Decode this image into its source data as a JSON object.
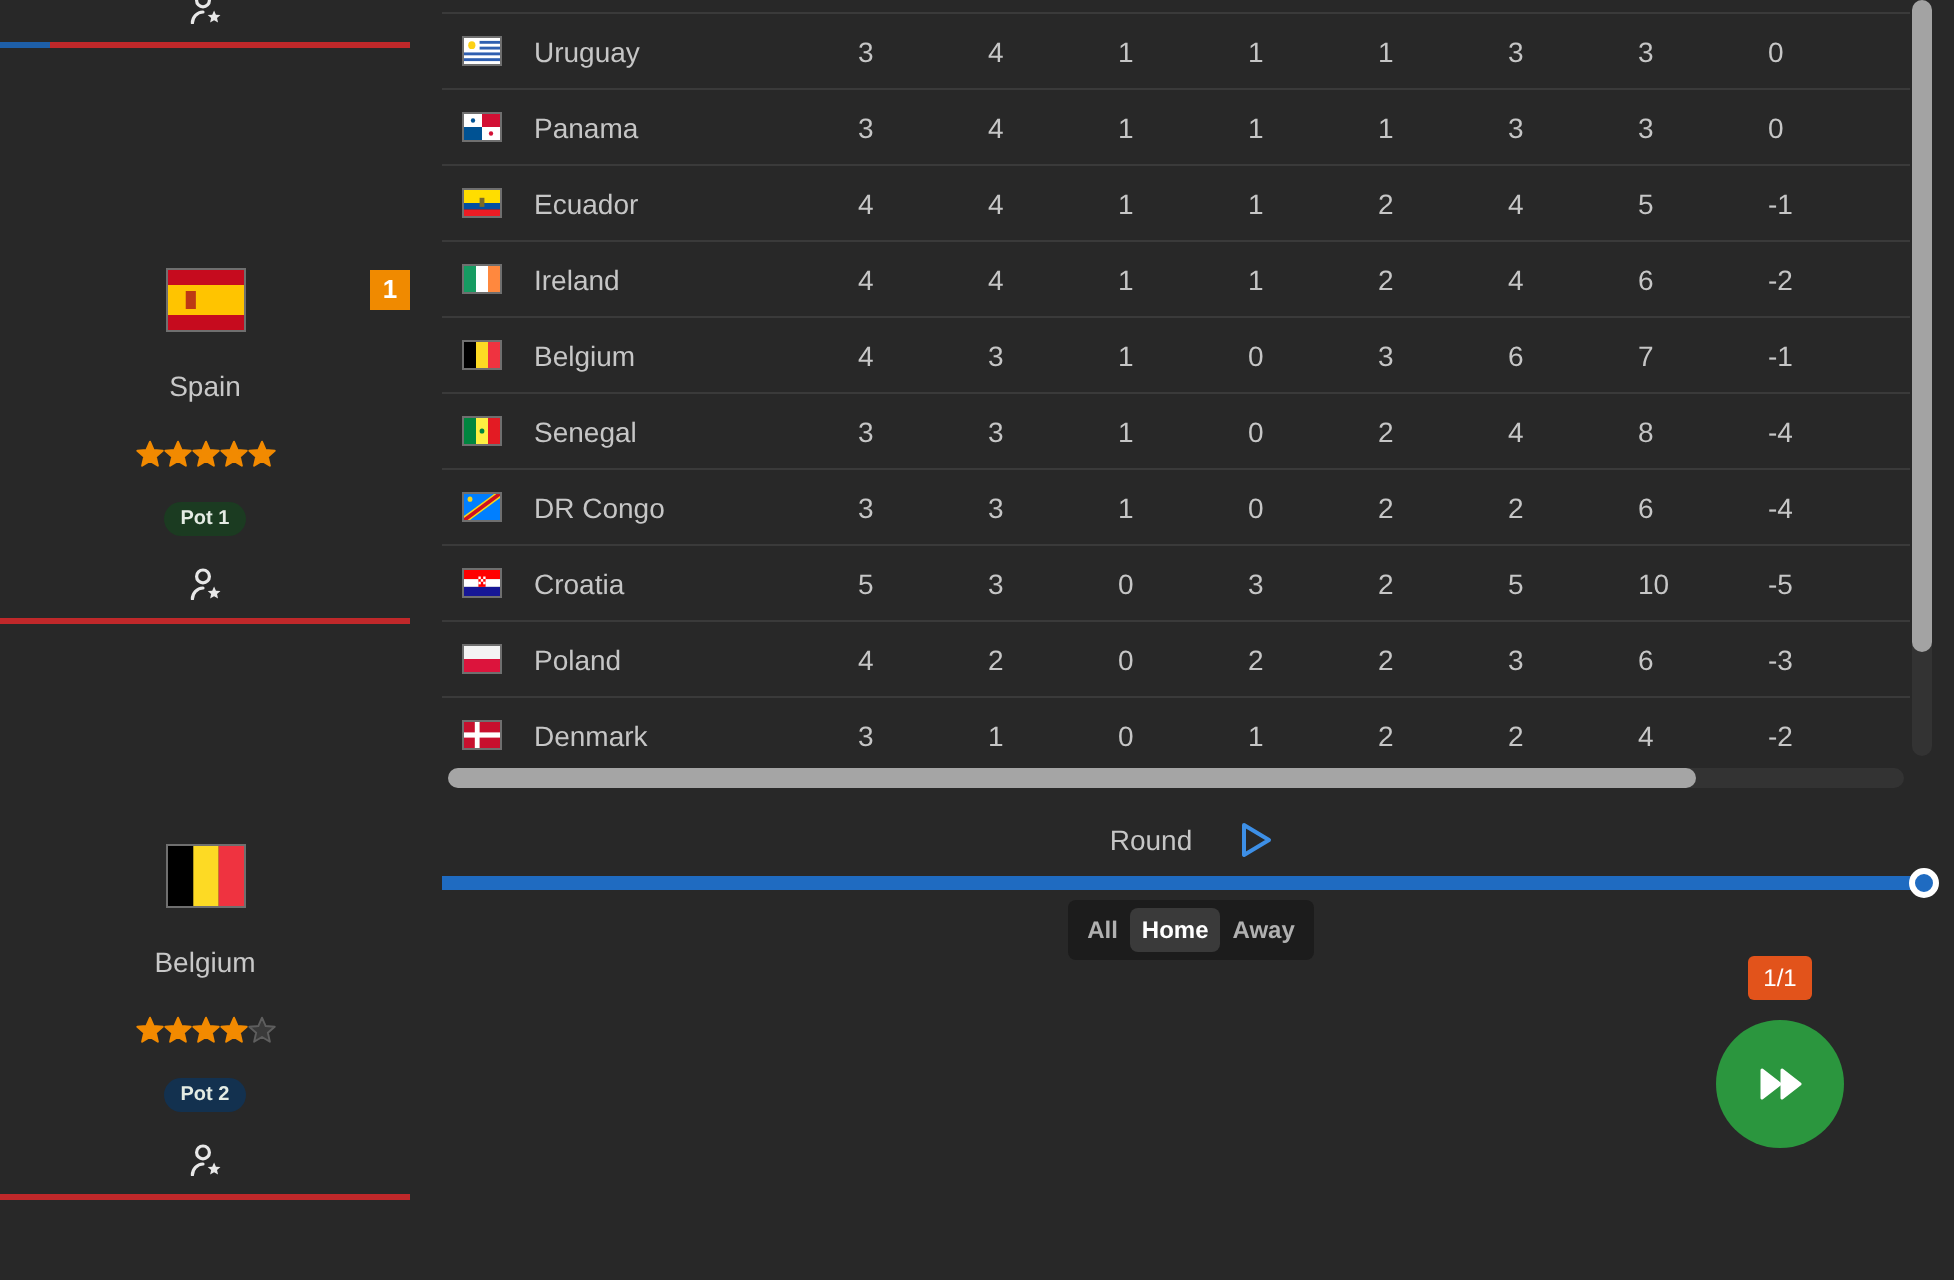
{
  "cards": [
    {
      "level": 0.12
    },
    {
      "name": "Spain",
      "kind": "spain",
      "badge": "1",
      "stars": 5,
      "pot": {
        "label": "Pot 1",
        "color": "#1b3b21"
      }
    },
    {
      "name": "Belgium",
      "kind": "belgium",
      "stars": 4,
      "pot": {
        "label": "Pot 2",
        "color": "#13314f"
      }
    }
  ],
  "table": {
    "rows": [
      {
        "kind": "uruguay",
        "country": "Uruguay",
        "cells": [
          "3",
          "4",
          "1",
          "1",
          "1",
          "3",
          "3",
          "0"
        ]
      },
      {
        "kind": "panama",
        "country": "Panama",
        "cells": [
          "3",
          "4",
          "1",
          "1",
          "1",
          "3",
          "3",
          "0"
        ]
      },
      {
        "kind": "ecuador",
        "country": "Ecuador",
        "cells": [
          "4",
          "4",
          "1",
          "1",
          "2",
          "4",
          "5",
          "-1"
        ]
      },
      {
        "kind": "ireland",
        "country": "Ireland",
        "cells": [
          "4",
          "4",
          "1",
          "1",
          "2",
          "4",
          "6",
          "-2"
        ]
      },
      {
        "kind": "belgium",
        "country": "Belgium",
        "cells": [
          "4",
          "3",
          "1",
          "0",
          "3",
          "6",
          "7",
          "-1"
        ]
      },
      {
        "kind": "senegal",
        "country": "Senegal",
        "cells": [
          "3",
          "3",
          "1",
          "0",
          "2",
          "4",
          "8",
          "-4"
        ]
      },
      {
        "kind": "drcongo",
        "country": "DR Congo",
        "cells": [
          "3",
          "3",
          "1",
          "0",
          "2",
          "2",
          "6",
          "-4"
        ]
      },
      {
        "kind": "croatia",
        "country": "Croatia",
        "cells": [
          "5",
          "3",
          "0",
          "3",
          "2",
          "5",
          "10",
          "-5"
        ]
      },
      {
        "kind": "poland",
        "country": "Poland",
        "cells": [
          "4",
          "2",
          "0",
          "2",
          "2",
          "3",
          "6",
          "-3"
        ]
      },
      {
        "kind": "denmark",
        "country": "Denmark",
        "cells": [
          "3",
          "1",
          "0",
          "1",
          "2",
          "2",
          "4",
          "-2"
        ]
      }
    ]
  },
  "round": {
    "label": "Round",
    "level": 1
  },
  "filter": [
    {
      "label": "All",
      "selected": false
    },
    {
      "label": "Home",
      "selected": true
    },
    {
      "label": "Away",
      "selected": false
    }
  ],
  "counter": "1/1"
}
